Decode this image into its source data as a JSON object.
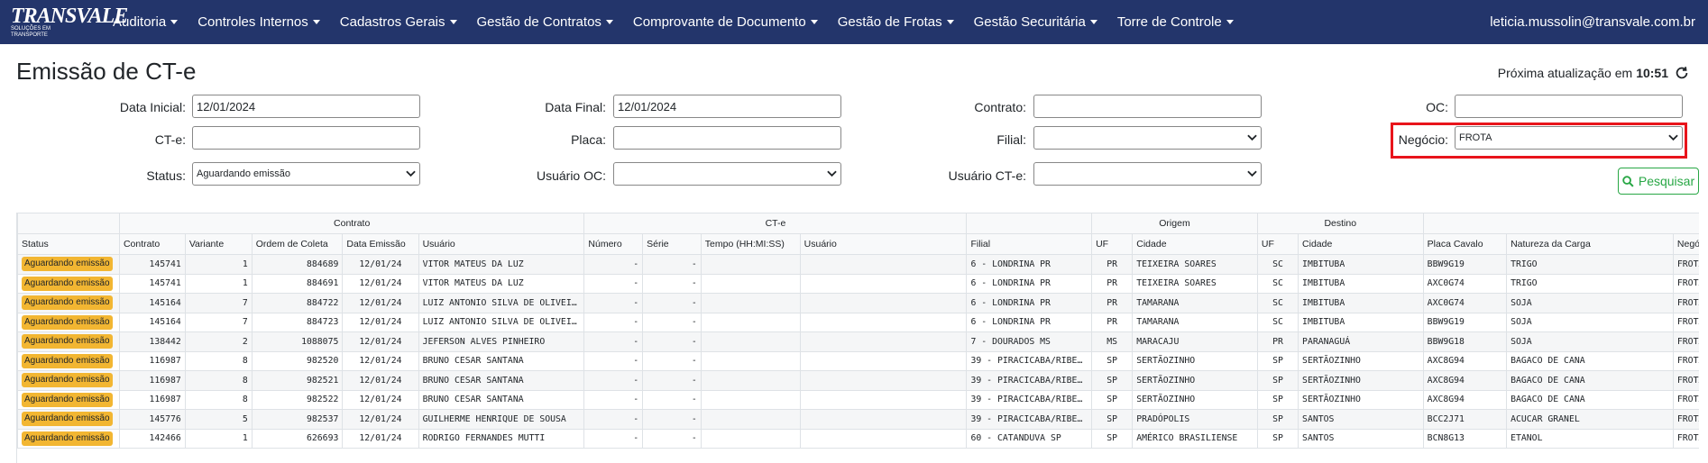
{
  "brand": {
    "main": "TRANSVALE",
    "sub": "SOLUÇÕES EM TRANSPORTE"
  },
  "nav": {
    "items": [
      {
        "label": "Auditoria"
      },
      {
        "label": "Controles Internos"
      },
      {
        "label": "Cadastros Gerais"
      },
      {
        "label": "Gestão de Contratos"
      },
      {
        "label": "Comprovante de Documento"
      },
      {
        "label": "Gestão de Frotas"
      },
      {
        "label": "Gestão Securitária"
      },
      {
        "label": "Torre de Controle"
      }
    ],
    "user_email": "leticia.mussolin@transvale.com.br"
  },
  "page": {
    "title": "Emissão de CT-e",
    "refresh_label": "Próxima atualização em",
    "refresh_time": "10:51"
  },
  "filters": {
    "data_inicial": {
      "label": "Data Inicial:",
      "value": "12/01/2024"
    },
    "data_final": {
      "label": "Data Final:",
      "value": "12/01/2024"
    },
    "contrato": {
      "label": "Contrato:",
      "value": ""
    },
    "oc": {
      "label": "OC:",
      "value": ""
    },
    "cte": {
      "label": "CT-e:",
      "value": ""
    },
    "placa": {
      "label": "Placa:",
      "value": ""
    },
    "filial": {
      "label": "Filial:",
      "value": ""
    },
    "negocio": {
      "label": "Negócio:",
      "value": "FROTA"
    },
    "status": {
      "label": "Status:",
      "value": "Aguardando emissão"
    },
    "usuario_oc": {
      "label": "Usuário OC:",
      "value": ""
    },
    "usuario_cte": {
      "label": "Usuário CT-e:",
      "value": ""
    },
    "search_label": "Pesquisar"
  },
  "table": {
    "groups": {
      "contrato": "Contrato",
      "cte": "CT-e",
      "origem": "Origem",
      "destino": "Destino"
    },
    "columns": {
      "status": "Status",
      "contrato": "Contrato",
      "variante": "Variante",
      "ordem_coleta": "Ordem de Coleta",
      "data_emissao": "Data Emissão",
      "usuario": "Usuário",
      "numero": "Número",
      "serie": "Série",
      "tempo": "Tempo (HH:MI:SS)",
      "cte_usuario": "Usuário",
      "filial": "Filial",
      "origem_uf": "UF",
      "origem_cidade": "Cidade",
      "destino_uf": "UF",
      "destino_cidade": "Cidade",
      "placa_cavalo": "Placa Cavalo",
      "natureza": "Natureza da Carga",
      "negocio": "Negócio"
    },
    "rows": [
      {
        "status": "Aguardando emissão",
        "contrato": "145741",
        "variante": "1",
        "ordem": "884689",
        "data": "12/01/24",
        "usuario": "VITOR MATEUS DA LUZ",
        "numero": "-",
        "serie": "-",
        "tempo": "",
        "cte_usuario": "",
        "filial": "6 - LONDRINA PR",
        "o_uf": "PR",
        "o_cidade": "TEIXEIRA SOARES",
        "d_uf": "SC",
        "d_cidade": "IMBITUBA",
        "placa": "BBW9G19",
        "natureza": "TRIGO",
        "negocio": "FROTA PROPRIA"
      },
      {
        "status": "Aguardando emissão",
        "contrato": "145741",
        "variante": "1",
        "ordem": "884691",
        "data": "12/01/24",
        "usuario": "VITOR MATEUS DA LUZ",
        "numero": "-",
        "serie": "-",
        "tempo": "",
        "cte_usuario": "",
        "filial": "6 - LONDRINA PR",
        "o_uf": "PR",
        "o_cidade": "TEIXEIRA SOARES",
        "d_uf": "SC",
        "d_cidade": "IMBITUBA",
        "placa": "AXC0G74",
        "natureza": "TRIGO",
        "negocio": "FROTA PROPRIA"
      },
      {
        "status": "Aguardando emissão",
        "contrato": "145164",
        "variante": "7",
        "ordem": "884722",
        "data": "12/01/24",
        "usuario": "LUIZ ANTONIO SILVA DE OLIVEI…",
        "numero": "-",
        "serie": "-",
        "tempo": "",
        "cte_usuario": "",
        "filial": "6 - LONDRINA PR",
        "o_uf": "PR",
        "o_cidade": "TAMARANA",
        "d_uf": "SC",
        "d_cidade": "IMBITUBA",
        "placa": "AXC0G74",
        "natureza": "SOJA",
        "negocio": "FROTA PROPRIA"
      },
      {
        "status": "Aguardando emissão",
        "contrato": "145164",
        "variante": "7",
        "ordem": "884723",
        "data": "12/01/24",
        "usuario": "LUIZ ANTONIO SILVA DE OLIVEI…",
        "numero": "-",
        "serie": "-",
        "tempo": "",
        "cte_usuario": "",
        "filial": "6 - LONDRINA PR",
        "o_uf": "PR",
        "o_cidade": "TAMARANA",
        "d_uf": "SC",
        "d_cidade": "IMBITUBA",
        "placa": "BBW9G19",
        "natureza": "SOJA",
        "negocio": "FROTA PROPRIA"
      },
      {
        "status": "Aguardando emissão",
        "contrato": "138442",
        "variante": "2",
        "ordem": "1088075",
        "data": "12/01/24",
        "usuario": "JEFERSON ALVES PINHEIRO",
        "numero": "-",
        "serie": "-",
        "tempo": "",
        "cte_usuario": "",
        "filial": "7 - DOURADOS MS",
        "o_uf": "MS",
        "o_cidade": "MARACAJU",
        "d_uf": "PR",
        "d_cidade": "PARANAGUÁ",
        "placa": "BBW9G18",
        "natureza": "SOJA",
        "negocio": "FROTA PROPRIA"
      },
      {
        "status": "Aguardando emissão",
        "contrato": "116987",
        "variante": "8",
        "ordem": "982520",
        "data": "12/01/24",
        "usuario": "BRUNO CESAR SANTANA",
        "numero": "-",
        "serie": "-",
        "tempo": "",
        "cte_usuario": "",
        "filial": "39 - PIRACICABA/RIBEI…",
        "o_uf": "SP",
        "o_cidade": "SERTÃOZINHO",
        "d_uf": "SP",
        "d_cidade": "SERTÃOZINHO",
        "placa": "AXC8G94",
        "natureza": "BAGACO DE CANA",
        "negocio": "FROTA PROPRIA"
      },
      {
        "status": "Aguardando emissão",
        "contrato": "116987",
        "variante": "8",
        "ordem": "982521",
        "data": "12/01/24",
        "usuario": "BRUNO CESAR SANTANA",
        "numero": "-",
        "serie": "-",
        "tempo": "",
        "cte_usuario": "",
        "filial": "39 - PIRACICABA/RIBEI…",
        "o_uf": "SP",
        "o_cidade": "SERTÃOZINHO",
        "d_uf": "SP",
        "d_cidade": "SERTÃOZINHO",
        "placa": "AXC8G94",
        "natureza": "BAGACO DE CANA",
        "negocio": "FROTA PROPRIA"
      },
      {
        "status": "Aguardando emissão",
        "contrato": "116987",
        "variante": "8",
        "ordem": "982522",
        "data": "12/01/24",
        "usuario": "BRUNO CESAR SANTANA",
        "numero": "-",
        "serie": "-",
        "tempo": "",
        "cte_usuario": "",
        "filial": "39 - PIRACICABA/RIBEI…",
        "o_uf": "SP",
        "o_cidade": "SERTÃOZINHO",
        "d_uf": "SP",
        "d_cidade": "SERTÃOZINHO",
        "placa": "AXC8G94",
        "natureza": "BAGACO DE CANA",
        "negocio": "FROTA PROPRIA"
      },
      {
        "status": "Aguardando emissão",
        "contrato": "145776",
        "variante": "5",
        "ordem": "982537",
        "data": "12/01/24",
        "usuario": "GUILHERME HENRIQUE DE SOUSA",
        "numero": "-",
        "serie": "-",
        "tempo": "",
        "cte_usuario": "",
        "filial": "39 - PIRACICABA/RIBEI…",
        "o_uf": "SP",
        "o_cidade": "PRADÓPOLIS",
        "d_uf": "SP",
        "d_cidade": "SANTOS",
        "placa": "BCC2J71",
        "natureza": "ACUCAR GRANEL",
        "negocio": "FROTA PROPRIA"
      },
      {
        "status": "Aguardando emissão",
        "contrato": "142466",
        "variante": "1",
        "ordem": "626693",
        "data": "12/01/24",
        "usuario": "RODRIGO FERNANDES MUTTI",
        "numero": "-",
        "serie": "-",
        "tempo": "",
        "cte_usuario": "",
        "filial": "60 - CATANDUVA SP",
        "o_uf": "SP",
        "o_cidade": "AMÉRICO BRASILIENSE",
        "d_uf": "SP",
        "d_cidade": "SANTOS",
        "placa": "BCN8G13",
        "natureza": "ETANOL",
        "negocio": "FROTA PROPRIA"
      }
    ]
  },
  "colors": {
    "navbar": "#23356b",
    "badge": "#f2b632",
    "highlight": "#e8141b",
    "search": "#28a745"
  }
}
